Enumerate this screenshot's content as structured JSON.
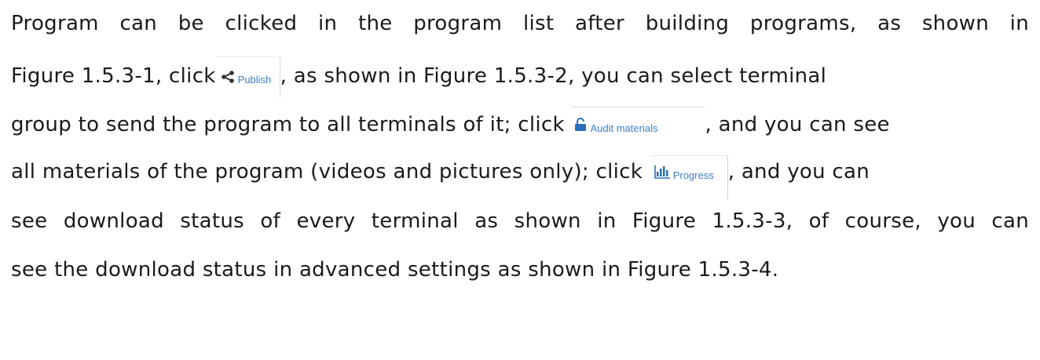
{
  "paragraph": {
    "line1": "Program can be clicked in the program list after building programs, as shown in",
    "line2_pre": "Figure 1.5.3-1, click",
    "line2_post": ", as shown in Figure 1.5.3-2, you can select terminal",
    "line3_pre": "group to send the program to all terminals of it; click",
    "line3_post": ", and you can see",
    "line4_pre": "all materials of the program (videos and pictures only); click",
    "line4_post": ", and you can",
    "line5": "see download status of every terminal as shown in Figure 1.5.3-3, of course, you can",
    "line6": "see the download status in advanced settings as shown in Figure 1.5.3-4."
  },
  "buttons": {
    "publish": {
      "label": "Publish",
      "icon": "share-icon"
    },
    "audit": {
      "label": "Audit materials",
      "icon": "unlock-icon"
    },
    "progress": {
      "label": "Progress",
      "icon": "bar-chart-icon"
    }
  },
  "colors": {
    "text": "#1a1a1a",
    "button_text": "#3b7ec8",
    "button_icon_dark": "#333333",
    "button_icon_blue": "#2a6ebb"
  }
}
